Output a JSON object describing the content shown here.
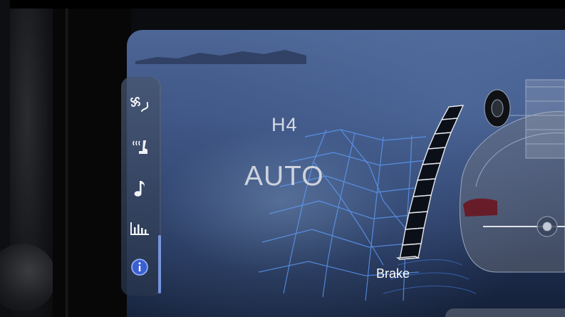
{
  "display": {
    "terrain_mode_top": "H4",
    "terrain_mode_main": "AUTO",
    "brake_label": "Brake"
  },
  "brake_gauge": {
    "segments_total": 12,
    "segments_lit": 0
  },
  "sidebar": {
    "items": [
      {
        "name": "climate-fan-icon",
        "selected": false
      },
      {
        "name": "seat-heater-icon",
        "selected": false
      },
      {
        "name": "music-note-icon",
        "selected": false
      },
      {
        "name": "bar-chart-icon",
        "selected": false
      },
      {
        "name": "info-icon",
        "selected": true
      }
    ]
  },
  "colors": {
    "accent": "#88aaff",
    "terrain_grid": "#5fa0ff",
    "text": "#d5dae3"
  }
}
